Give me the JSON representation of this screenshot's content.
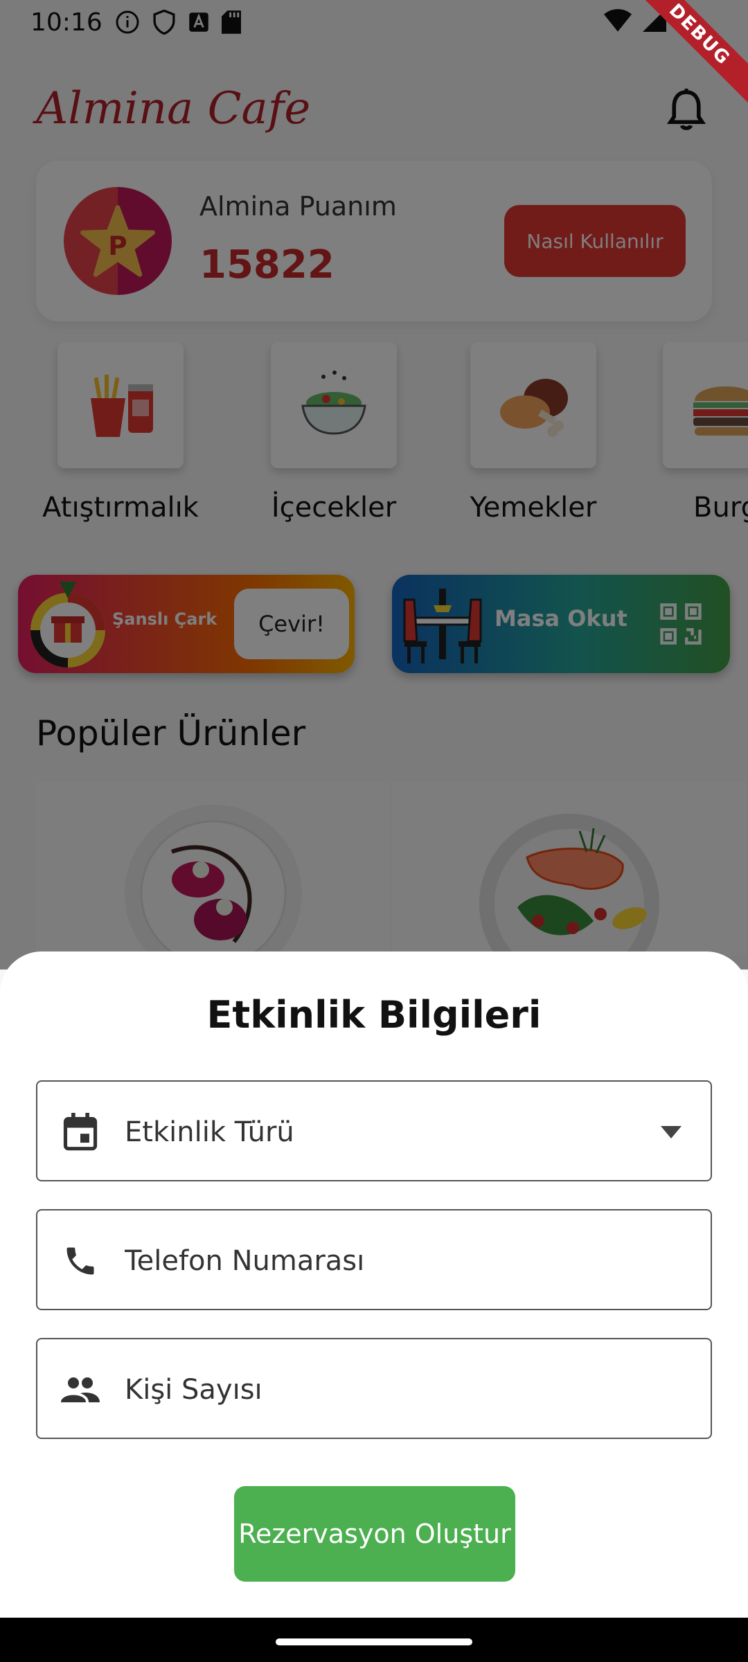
{
  "status_bar": {
    "time": "10:16",
    "debug": "DEBUG"
  },
  "header": {
    "brand": "Almina Cafe"
  },
  "points": {
    "label": "Almina Puanım",
    "value": "15822",
    "badge_letter": "P",
    "how_to_button": "Nasıl Kullanılır"
  },
  "categories": [
    {
      "label": "Atıştırmalık",
      "icon": "fries-soda-icon"
    },
    {
      "label": "İçecekler",
      "icon": "salad-bowl-icon"
    },
    {
      "label": "Yemekler",
      "icon": "chicken-leg-icon"
    },
    {
      "label": "Burg",
      "icon": "burger-icon"
    }
  ],
  "promos": {
    "wheel_label": "Şanslı Çark",
    "spin_button": "Çevir!",
    "table_label": "Masa Okut"
  },
  "popular": {
    "title": "Popüler Ürünler"
  },
  "sheet": {
    "title": "Etkinlik Bilgileri",
    "event_type_placeholder": "Etkinlik Türü",
    "phone_placeholder": "Telefon Numarası",
    "people_placeholder": "Kişi Sayısı",
    "submit_button": "Rezervasyon Oluştur"
  },
  "colors": {
    "brand": "#b3202a",
    "accent_red": "#e53935",
    "submit_green": "#4caf50"
  }
}
